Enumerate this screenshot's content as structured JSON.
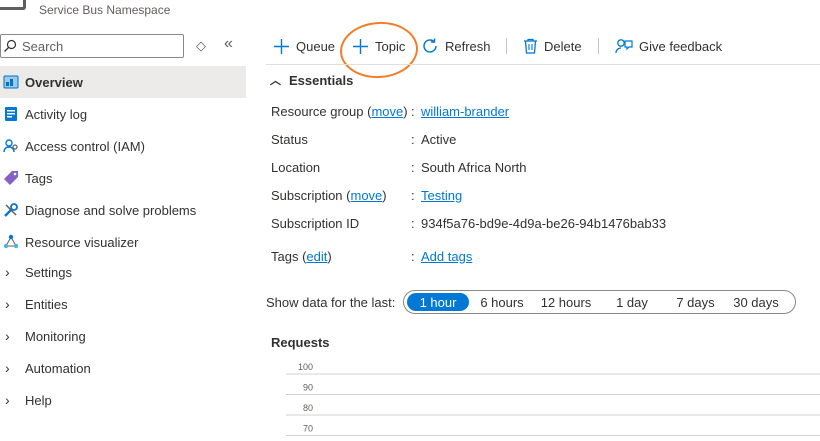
{
  "header": {
    "subtitle": "Service Bus Namespace"
  },
  "sidebar": {
    "search_placeholder": "Search",
    "collapse_label": "«",
    "updown_label": "◇",
    "items": [
      {
        "label": "Overview",
        "icon": "overview-icon",
        "active": true
      },
      {
        "label": "Activity log",
        "icon": "activity-log-icon"
      },
      {
        "label": "Access control (IAM)",
        "icon": "iam-icon"
      },
      {
        "label": "Tags",
        "icon": "tag-icon"
      },
      {
        "label": "Diagnose and solve problems",
        "icon": "wrench-icon"
      },
      {
        "label": "Resource visualizer",
        "icon": "visualizer-icon"
      },
      {
        "label": "Settings",
        "expandable": true
      },
      {
        "label": "Entities",
        "expandable": true
      },
      {
        "label": "Monitoring",
        "expandable": true
      },
      {
        "label": "Automation",
        "expandable": true
      },
      {
        "label": "Help",
        "expandable": true
      }
    ]
  },
  "toolbar": {
    "queue": "Queue",
    "topic": "Topic",
    "refresh": "Refresh",
    "delete": "Delete",
    "feedback": "Give feedback"
  },
  "essentials": {
    "title": "Essentials",
    "rows": {
      "resource_group": {
        "label": "Resource group",
        "action": "move",
        "value": "william-brander"
      },
      "status": {
        "label": "Status",
        "value": "Active"
      },
      "location": {
        "label": "Location",
        "value": "South Africa North"
      },
      "subscription": {
        "label": "Subscription",
        "action": "move",
        "value": "Testing"
      },
      "subscription_id": {
        "label": "Subscription ID",
        "value": "934f5a76-bd9e-4d9a-be26-94b1476bab33"
      },
      "tags": {
        "label": "Tags",
        "action": "edit",
        "value": "Add tags"
      }
    }
  },
  "time_range": {
    "label": "Show data for the last:",
    "options": [
      "1 hour",
      "6 hours",
      "12 hours",
      "1 day",
      "7 days",
      "30 days"
    ],
    "selected": "1 hour"
  },
  "chart_data": {
    "type": "line",
    "title": "Requests",
    "y_ticks": [
      100,
      90,
      80,
      70
    ],
    "series": []
  },
  "colors": {
    "accent": "#0078d4",
    "highlight_annotation": "#f27d26",
    "active_nav_bg": "#edebe9"
  }
}
